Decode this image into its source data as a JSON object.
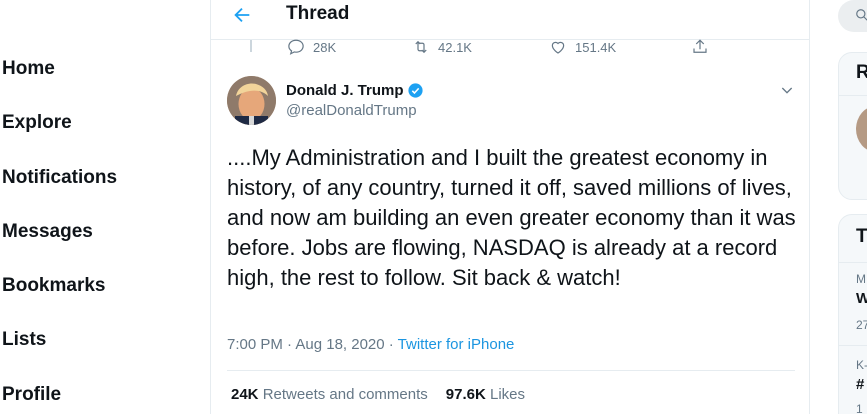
{
  "nav": {
    "items": [
      {
        "label": "Home"
      },
      {
        "label": "Explore"
      },
      {
        "label": "Notifications"
      },
      {
        "label": "Messages"
      },
      {
        "label": "Bookmarks"
      },
      {
        "label": "Lists"
      },
      {
        "label": "Profile"
      }
    ]
  },
  "header": {
    "title": "Thread",
    "back_icon": "arrow-left-icon"
  },
  "previous_tweet_actions": {
    "replies": "28K",
    "retweets": "42.1K",
    "likes": "151.4K"
  },
  "tweet": {
    "author_name": "Donald J. Trump",
    "author_handle": "@realDonaldTrump",
    "verified": true,
    "text": "....My Administration and I built the greatest economy in history, of any country, turned it off, saved millions of lives, and now am building an even greater economy than it was before. Jobs are flowing, NASDAQ is already at a record high, the rest to follow. Sit back & watch!",
    "timestamp": "7:00 PM · Aug 18, 2020 · ",
    "source": "Twitter for iPhone",
    "retweets_count": "24K",
    "retweets_label": "Retweets and comments",
    "likes_count": "97.6K",
    "likes_label": "Likes"
  },
  "sidebar": {
    "panel1_title": "R",
    "panel2_title": "T",
    "trend1_context": "M",
    "trend1_name": "W",
    "trend1_count": "27",
    "trend2_context": "K-",
    "trend2_name": "#",
    "trend2_count": "1"
  },
  "colors": {
    "accent": "#1da1f2",
    "link": "#1b95e0",
    "secondary_text": "#657786",
    "border": "#e6ecf0"
  }
}
